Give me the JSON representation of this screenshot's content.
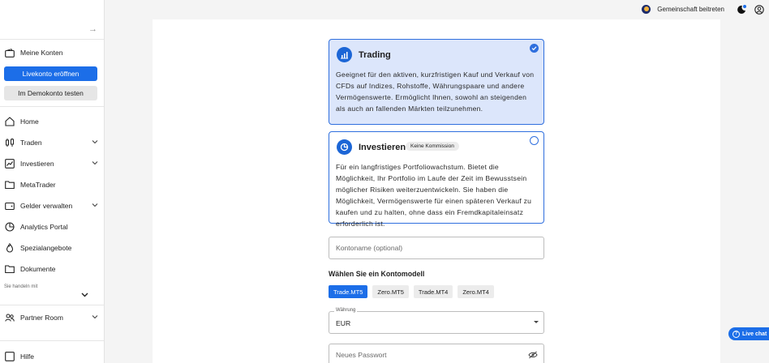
{
  "sidebar": {
    "my_accounts": "Meine Konten",
    "live_account_button": "Livekonto eröffnen",
    "demo_account_button": "Im Demokonto testen",
    "items": [
      {
        "label": "Home",
        "icon": "home-icon"
      },
      {
        "label": "Traden",
        "icon": "candles-icon"
      },
      {
        "label": "Investieren",
        "icon": "chart-icon"
      },
      {
        "label": "MetaTrader",
        "icon": "folder-icon"
      },
      {
        "label": "Gelder verwalten",
        "icon": "wallet-icon"
      },
      {
        "label": "Analytics Portal",
        "icon": "analytics-icon"
      },
      {
        "label": "Spezialangebote",
        "icon": "flame-icon"
      },
      {
        "label": "Dokumente",
        "icon": "document-icon"
      }
    ],
    "trade_with": "Sie handeln mit",
    "partner_room": "Partner Room",
    "help": "Hilfe"
  },
  "topbar": {
    "community": "Gemeinschaft beitreten"
  },
  "cards": {
    "trading": {
      "title": "Trading",
      "description": "Geeignet für den aktiven, kurzfristigen Kauf und Verkauf von CFDs auf Indizes, Rohstoffe, Währungspaare und andere Vermögenswerte. Ermöglicht Ihnen, sowohl an steigenden als auch an fallenden Märkten teilzunehmen.",
      "selected": true
    },
    "investing": {
      "title": "Investieren",
      "badge": "Keine Kommission",
      "description": "Für ein langfristiges Portfoliowachstum. Bietet die Möglichkeit, Ihr Portfolio im Laufe der Zeit im Bewusstsein möglicher Risiken weiterzuentwickeln. Sie haben die Möglichkeit, Vermögenswerte für einen späteren Verkauf zu kaufen und zu halten, ohne dass ein Fremdkapitaleinsatz erforderlich ist.",
      "selected": false
    }
  },
  "form": {
    "account_name_placeholder": "Kontoname (optional)",
    "model_title": "Wählen Sie ein Kontomodell",
    "models": [
      "Trade.MT5",
      "Zero.MT5",
      "Trade.MT4",
      "Zero.MT4"
    ],
    "active_model": "Trade.MT5",
    "currency_label": "Währung",
    "currency_value": "EUR",
    "password_placeholder": "Neues Passwort"
  },
  "livechat": "Live chat",
  "colors": {
    "accent": "#1c6ee8",
    "card_selected_bg": "#dce6fb"
  }
}
